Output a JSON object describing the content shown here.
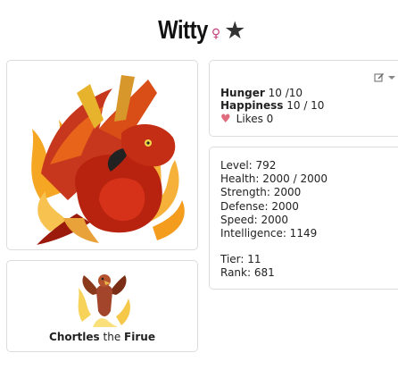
{
  "pet": {
    "name": "Witty",
    "gender_symbol": "♀",
    "favorite_icon": "star-icon"
  },
  "needs": {
    "hunger_label": "Hunger",
    "hunger_value": "10 /10",
    "happiness_label": "Happiness",
    "happiness_value": "10 / 10",
    "likes_text": "Likes 0",
    "heart_icon": "heart-icon",
    "edit_icon": "edit-icon"
  },
  "stats": {
    "level": "Level: 792",
    "health": "Health: 2000 / 2000",
    "strength": "Strength: 2000",
    "defense": "Defense: 2000",
    "speed": "Speed: 2000",
    "intelligence": "Intelligence: 1149",
    "tier": "Tier: 11",
    "rank": "Rank: 681"
  },
  "companion": {
    "name": "Chortles",
    "connector": "the",
    "species": "Firue"
  },
  "colors": {
    "star": "#333333",
    "gender": "#c0407a",
    "heart": "#e06b7d",
    "panel_border": "#dcdcdc"
  }
}
